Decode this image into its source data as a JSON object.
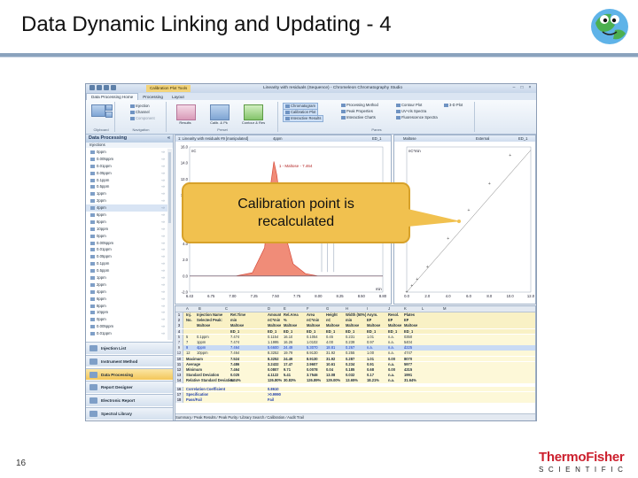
{
  "slide": {
    "title": "Data Dynamic Linking and Updating - 4",
    "page_number": "16",
    "logo_brand": "ThermoFisher",
    "logo_sub": "SCIENTIFIC",
    "callout_line1": "Calibration point is",
    "callout_line2": "recalculated"
  },
  "app": {
    "context_tab": "Calibration Plot Tools",
    "window_title": "Linearity with residuals (Sequence) - Chromeleon Chromatography Studio",
    "tabs": [
      "Data Processing Home",
      "Processing",
      "Layout"
    ],
    "ribbon": {
      "clipboard_label": "Clipboard",
      "navigation_label": "Navigation",
      "nav_items": [
        "Injection",
        "Channel",
        "Component"
      ],
      "results_label": "Results",
      "calib_label": "Calib. & Pk",
      "contour_label": "Contour & Res",
      "preset_label": "Preset",
      "panes_label": "Panes",
      "pane_items": [
        "Chromatogram",
        "Calibration Plot",
        "Interactive Results",
        "Processing Method",
        "Peak Properties",
        "Interactive Charts",
        "Contour Plot",
        "UV-Vis Spectra",
        "Fluorescence Spectra",
        "3-D Plot"
      ]
    }
  },
  "left_pane": {
    "header": "Data Processing",
    "sub": "Injections",
    "injections": [
      "0ppm",
      "0.005ppm",
      "0.01ppm",
      "0.05ppm",
      "0.1ppm",
      "0.5ppm",
      "1ppm",
      "2ppm",
      "4ppm",
      "6ppm",
      "8ppm",
      "10ppm",
      "0ppm",
      "0.005ppm",
      "0.01ppm",
      "0.05ppm",
      "0.1ppm",
      "0.5ppm",
      "1ppm",
      "2ppm",
      "4ppm",
      "6ppm",
      "8ppm",
      "10ppm",
      "0ppm",
      "0.005ppm",
      "0.01ppm"
    ],
    "selected_index": 8,
    "nav_buttons": [
      "Injection List",
      "Instrument Method",
      "Data Processing",
      "Report Designer",
      "Electronic Report",
      "Spectral Library"
    ],
    "active_nav": 2
  },
  "chromatogram": {
    "header": "1: Linearity with residuals #9 [manipulated]",
    "header_mid": "4ppm",
    "header_right": "ED_1",
    "yunit": "nC",
    "xunit": "min",
    "peak_label": "1 - Maltose - 7.464",
    "yticks": [
      "16.0",
      "14.0",
      "12.0",
      "10.0",
      "8.0",
      "6.0",
      "4.0",
      "2.0",
      "0.0",
      "-2.0"
    ],
    "xticks": [
      "6.43",
      "6.75",
      "7.00",
      "7.25",
      "7.50",
      "7.75",
      "8.00",
      "8.25",
      "8.50",
      "8.80"
    ],
    "chart_data": {
      "type": "line",
      "xlabel": "min",
      "ylabel": "nC",
      "xlim": [
        6.43,
        8.8
      ],
      "ylim": [
        -2.0,
        16.0
      ],
      "series": [
        {
          "name": "Maltose",
          "x": [
            6.43,
            7.0,
            7.2,
            7.35,
            7.42,
            7.464,
            7.5,
            7.58,
            7.7,
            7.85,
            8.0,
            8.8
          ],
          "y": [
            0.0,
            0.0,
            0.4,
            3.5,
            11.0,
            14.2,
            12.5,
            6.0,
            1.5,
            0.3,
            0.0,
            0.0
          ]
        }
      ]
    }
  },
  "calibration": {
    "header_left": "Maltose",
    "header_mid": "External",
    "header_right": "ED_1",
    "yunit": "nC*min",
    "xticks": [
      "0.0",
      "2.0",
      "4.0",
      "6.0",
      "8.0",
      "10.0",
      "12.0"
    ],
    "chart_data": {
      "type": "scatter",
      "xlim": [
        0,
        12
      ],
      "series": [
        {
          "name": "Maltose",
          "x": [
            0,
            0.5,
            1,
            2,
            4,
            6,
            8,
            10
          ],
          "y": [
            0.0,
            0.06,
            0.12,
            0.24,
            0.51,
            0.78,
            1.03,
            1.3
          ]
        }
      ]
    }
  },
  "sheet": {
    "columns": [
      "A",
      "B",
      "C",
      "D",
      "E",
      "F",
      "G",
      "H",
      "I",
      "J",
      "K",
      "L",
      "M"
    ],
    "header_rows": [
      [
        "1",
        "Inj.",
        "Injection Name",
        "Ret.Time",
        "Amount",
        "Rel.Area",
        "Area",
        "Height",
        "Width (50%)",
        "Asym.",
        "Resol.",
        "Plates"
      ],
      [
        "2",
        "No.",
        "Selected Peak:",
        "min",
        "nC*min",
        "%",
        "nC*min",
        "nC",
        "min",
        "EP",
        "EP",
        "EP"
      ],
      [
        "3",
        "",
        "Maltose",
        "Maltose",
        "Maltose",
        "Maltose",
        "Maltose",
        "Maltose",
        "Maltose",
        "Maltose",
        "Maltose",
        "Maltose"
      ],
      [
        "4",
        "",
        "",
        "ED_1",
        "ED_1",
        "ED_1",
        "ED_1",
        "ED_1",
        "ED_1",
        "ED_1",
        "ED_1",
        "ED_1"
      ]
    ],
    "data_rows": [
      [
        "5",
        "5",
        "0.1ppm",
        "7.474",
        "0.1154",
        "16.10",
        "0.1054",
        "0.45",
        "0.231",
        "1.01",
        "n.a.",
        "0350"
      ],
      [
        "7",
        "7",
        "1ppm",
        "7.474",
        "1.1995",
        "16.26",
        "1.0102",
        "4.00",
        "0.239",
        "0.97",
        "n.a.",
        "5404"
      ],
      [
        "9",
        "9",
        "4ppm",
        "7.464",
        "5.6600",
        "24.49",
        "5.3070",
        "18.81",
        "0.267",
        "n.a.",
        "n.a.",
        "d225"
      ],
      [
        "12",
        "12",
        "10ppm",
        "7.464",
        "8.3252",
        "19.79",
        "8.9130",
        "31.92",
        "0.255",
        "1.00",
        "n.a.",
        "4747"
      ]
    ],
    "selected_row": 2,
    "stat_rows": [
      [
        "10",
        "Maximum",
        "",
        "7.524",
        "8.3252",
        "24.49",
        "8.9130",
        "31.92",
        "0.287",
        "1.01",
        "0.00",
        "8070"
      ],
      [
        "11",
        "Average",
        "",
        "7.486",
        "3.2432",
        "17.47",
        "2.9607",
        "10.61",
        "0.234",
        "0.91",
        "n.a.",
        "5977"
      ],
      [
        "12",
        "Minimum",
        "",
        "7.464",
        "0.0807",
        "9.71",
        "0.0078",
        "0.04",
        "0.185",
        "0.68",
        "0.00",
        "4315"
      ],
      [
        "13",
        "Standard Deviation",
        "",
        "0.025",
        "4.1122",
        "5.41",
        "3.7546",
        "13.08",
        "0.032",
        "0.17",
        "n.a.",
        "1991"
      ],
      [
        "14",
        "Relative Standard Deviation",
        "",
        "0.34%",
        "126.80%",
        "30.83%",
        "126.89%",
        "129.00%",
        "13.65%",
        "18.21%",
        "n.a.",
        "31.64%"
      ]
    ],
    "info_rows": [
      [
        "16",
        "Correlation Coefficient",
        "",
        "0.8610"
      ],
      [
        "17",
        "Specification",
        "",
        "&gt;0.9990"
      ],
      [
        "18",
        "Pass/Fail",
        "",
        "Fail"
      ]
    ],
    "sheet_tabs": "Summary  ⁄ Peak Results  ⁄ Peak Purity  ⁄ Library Search  ⁄ Calibration  ⁄ Audit Trail"
  }
}
